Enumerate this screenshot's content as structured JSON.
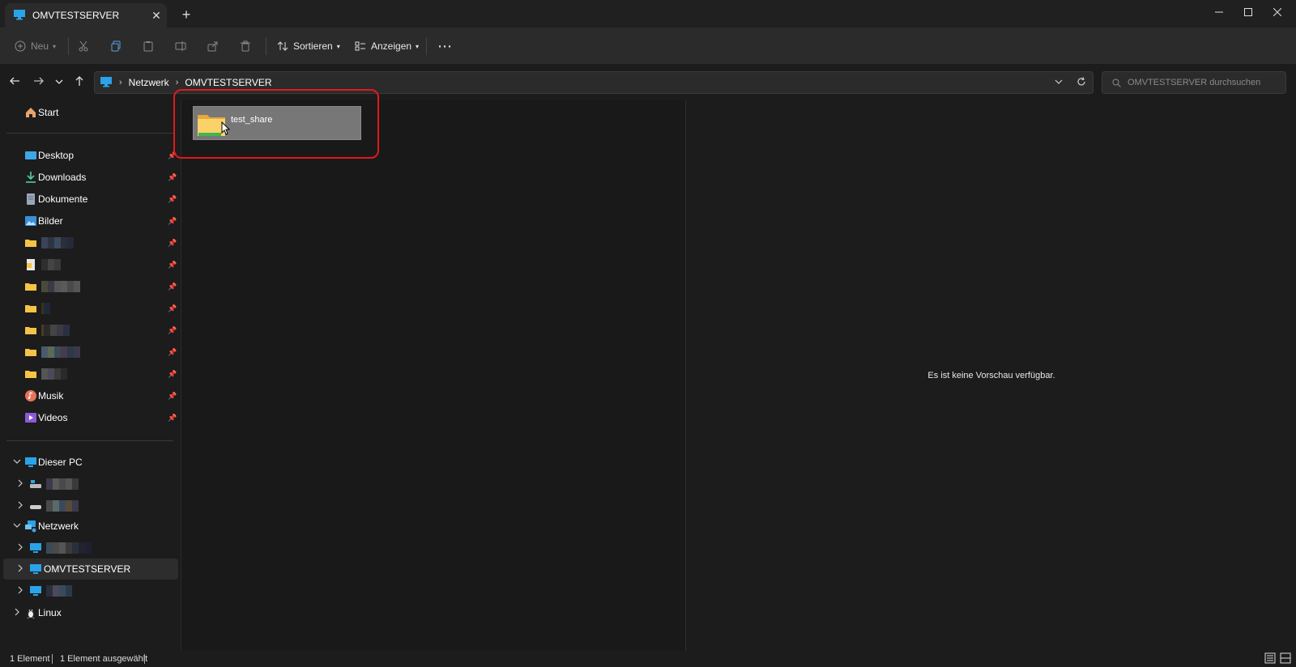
{
  "window": {
    "tab_title": "OMVTESTSERVER",
    "tab_close": "✕",
    "new_tab": "+"
  },
  "toolbar": {
    "new_label": "Neu",
    "sort_label": "Sortieren",
    "view_label": "Anzeigen",
    "more_label": "⋯"
  },
  "address": {
    "crumbs": [
      "Netzwerk",
      "OMVTESTSERVER"
    ],
    "search_placeholder": "OMVTESTSERVER durchsuchen"
  },
  "sidebar": {
    "home": "Start",
    "quick": [
      {
        "label": "Desktop"
      },
      {
        "label": "Downloads"
      },
      {
        "label": "Dokumente"
      },
      {
        "label": "Bilder"
      },
      {
        "label": "Musik"
      },
      {
        "label": "Videos"
      }
    ],
    "this_pc": "Dieser PC",
    "network": "Netzwerk",
    "server": "OMVTESTSERVER",
    "linux": "Linux"
  },
  "content": {
    "items": [
      {
        "name": "test_share"
      }
    ]
  },
  "preview": {
    "message": "Es ist keine Vorschau verfügbar."
  },
  "status": {
    "count": "1 Element",
    "selected": "1 Element ausgewählt"
  },
  "colors": {
    "accent_highlight": "#e01a1a",
    "folder": "#f6c445",
    "selected_tile": "#777777"
  }
}
